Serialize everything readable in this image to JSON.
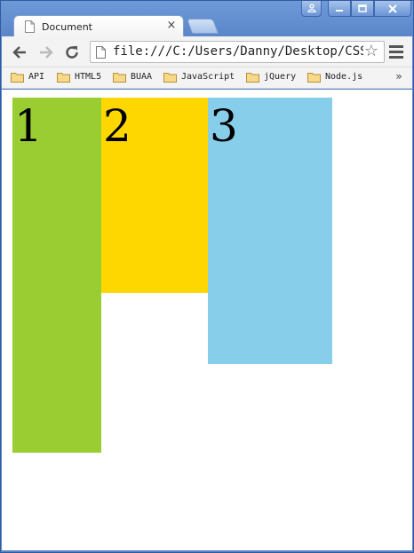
{
  "browser": {
    "tab_title": "Document",
    "tab_close": "×",
    "address": "file:///C:/Users/Danny/Desktop/CSS/",
    "window_buttons": {
      "user": "user-icon",
      "minimize": "minimize-icon",
      "maximize": "maximize-icon",
      "close": "close-icon"
    },
    "nav": {
      "back": "←",
      "forward": "→",
      "reload": "↻"
    },
    "star": "☆"
  },
  "bookmarks": [
    {
      "label": "API"
    },
    {
      "label": "HTML5"
    },
    {
      "label": "BUAA"
    },
    {
      "label": "JavaScript"
    },
    {
      "label": "jQuery"
    },
    {
      "label": "Node.js"
    }
  ],
  "bookmarks_more": "»",
  "page": {
    "boxes": [
      {
        "label": "1",
        "color": "#9acd32"
      },
      {
        "label": "2",
        "color": "#ffd700"
      },
      {
        "label": "3",
        "color": "#87ceeb"
      }
    ]
  }
}
